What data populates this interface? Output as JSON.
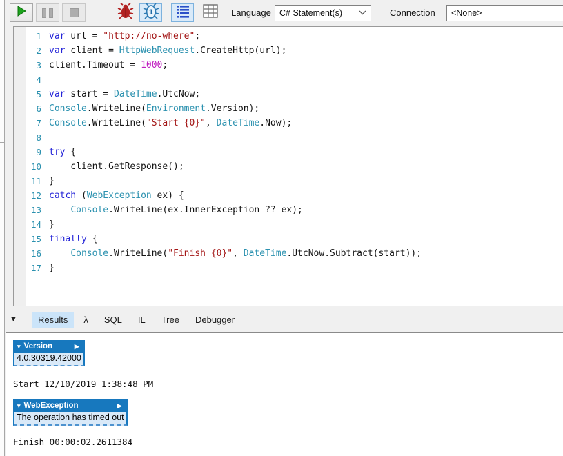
{
  "colors": {
    "accent_blue": "#1778BE",
    "selected_bg": "#CBE4F9",
    "keyword": "#2626D8",
    "type_name": "#2B91AF",
    "string_literal": "#A31515",
    "number_literal": "#C120C1",
    "line_number": "#2B91AF",
    "run_green": "#1CA31C",
    "bug_red": "#B22222"
  },
  "toolbar": {
    "icons": [
      "play-icon",
      "pause-icon",
      "stop-icon",
      "red-bug-icon",
      "blue-bug-1-icon",
      "rich-text-list-icon",
      "data-grid-icon",
      "chevron-down-icon"
    ],
    "bug_badge": "1",
    "language_label": "Language",
    "language_value": "C# Statement(s)",
    "connection_label": "Connection",
    "connection_value": "<None>"
  },
  "editor": {
    "lines": [
      {
        "n": "1",
        "tokens": [
          [
            "kw",
            "var"
          ],
          [
            "pl",
            " url = "
          ],
          [
            "str",
            "\"http://no-where\""
          ],
          [
            "pl",
            ";"
          ]
        ]
      },
      {
        "n": "2",
        "tokens": [
          [
            "kw",
            "var"
          ],
          [
            "pl",
            " client = "
          ],
          [
            "ty",
            "HttpWebRequest"
          ],
          [
            "pl",
            ".CreateHttp(url);"
          ]
        ]
      },
      {
        "n": "3",
        "tokens": [
          [
            "pl",
            "client.Timeout = "
          ],
          [
            "num",
            "1000"
          ],
          [
            "pl",
            ";"
          ]
        ]
      },
      {
        "n": "4",
        "tokens": []
      },
      {
        "n": "5",
        "tokens": [
          [
            "kw",
            "var"
          ],
          [
            "pl",
            " start = "
          ],
          [
            "ty",
            "DateTime"
          ],
          [
            "pl",
            ".UtcNow;"
          ]
        ]
      },
      {
        "n": "6",
        "tokens": [
          [
            "ty",
            "Console"
          ],
          [
            "pl",
            ".WriteLine("
          ],
          [
            "ty",
            "Environment"
          ],
          [
            "pl",
            ".Version);"
          ]
        ]
      },
      {
        "n": "7",
        "tokens": [
          [
            "ty",
            "Console"
          ],
          [
            "pl",
            ".WriteLine("
          ],
          [
            "str",
            "\"Start {0}\""
          ],
          [
            "pl",
            ", "
          ],
          [
            "ty",
            "DateTime"
          ],
          [
            "pl",
            ".Now);"
          ]
        ]
      },
      {
        "n": "8",
        "tokens": []
      },
      {
        "n": "9",
        "tokens": [
          [
            "kw",
            "try"
          ],
          [
            "pl",
            " {"
          ]
        ]
      },
      {
        "n": "10",
        "tokens": [
          [
            "pl",
            "    client.GetResponse();"
          ]
        ]
      },
      {
        "n": "11",
        "tokens": [
          [
            "pl",
            "}"
          ]
        ]
      },
      {
        "n": "12",
        "tokens": [
          [
            "kw",
            "catch"
          ],
          [
            "pl",
            " ("
          ],
          [
            "ty",
            "WebException"
          ],
          [
            "pl",
            " ex) {"
          ]
        ]
      },
      {
        "n": "13",
        "tokens": [
          [
            "pl",
            "    "
          ],
          [
            "ty",
            "Console"
          ],
          [
            "pl",
            ".WriteLine(ex.InnerException ?? ex);"
          ]
        ]
      },
      {
        "n": "14",
        "tokens": [
          [
            "pl",
            "}"
          ]
        ]
      },
      {
        "n": "15",
        "tokens": [
          [
            "kw",
            "finally"
          ],
          [
            "pl",
            " {"
          ]
        ]
      },
      {
        "n": "16",
        "tokens": [
          [
            "pl",
            "    "
          ],
          [
            "ty",
            "Console"
          ],
          [
            "pl",
            ".WriteLine("
          ],
          [
            "str",
            "\"Finish {0}\""
          ],
          [
            "pl",
            ", "
          ],
          [
            "ty",
            "DateTime"
          ],
          [
            "pl",
            ".UtcNow.Subtract(start));"
          ]
        ]
      },
      {
        "n": "17",
        "tokens": [
          [
            "pl",
            "}"
          ]
        ]
      }
    ]
  },
  "results_panel": {
    "collapse_icon": "▼",
    "tabs": [
      {
        "key": "results",
        "label": "Results",
        "selected": true
      },
      {
        "key": "lambda",
        "label": "λ"
      },
      {
        "key": "sql",
        "label": "SQL"
      },
      {
        "key": "il",
        "label": "IL"
      },
      {
        "key": "tree",
        "label": "Tree"
      },
      {
        "key": "debugger",
        "label": "Debugger"
      }
    ],
    "items": [
      {
        "type": "box",
        "key": "version",
        "title": "Version",
        "value": "4.0.30319.42000"
      },
      {
        "type": "text",
        "key": "start-line",
        "value": "Start 12/10/2019 1:38:48 PM"
      },
      {
        "type": "box",
        "key": "webexception",
        "title": "WebException",
        "value": "The operation has timed out"
      },
      {
        "type": "text",
        "key": "finish-line",
        "value": "Finish 00:00:02.2611384"
      }
    ]
  }
}
